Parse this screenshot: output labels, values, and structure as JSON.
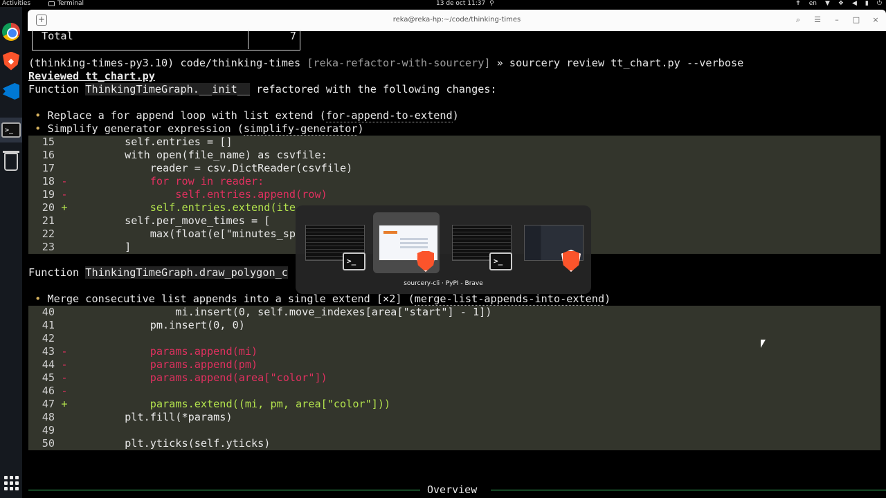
{
  "topbar": {
    "activities": "Activities",
    "app_name": "Terminal",
    "clock": "13 de oct  11:37",
    "language": "en"
  },
  "dock": {
    "items": [
      "chrome-icon",
      "brave-icon",
      "vscode-icon",
      "terminal-icon",
      "trash-icon",
      "app-grid-icon"
    ]
  },
  "terminal": {
    "title": "reka@reka-hp:~/code/thinking-times",
    "table": {
      "label": "Total",
      "value": "7"
    },
    "prompt": {
      "env": "(thinking-times-py3.10) code/thinking-times ",
      "branch": "[reka-refactor-with-sourcery]",
      "command": " » sourcery review tt_chart.py --verbose"
    },
    "reviewed": "Reviewed tt_chart.py",
    "func1": {
      "prefix": "Function ",
      "name": "ThinkingTimeGraph.__init__",
      "suffix": " refactored with the following changes:"
    },
    "bullets1": [
      {
        "text": "Replace a for append loop with list extend (",
        "code": "for-append-to-extend",
        "end": ")"
      },
      {
        "text": "Simplify generator expression (",
        "code": "simplify-generator",
        "end": ")"
      }
    ],
    "diff1": [
      {
        "n": "15",
        "m": " ",
        "t": "        self.entries = []",
        "k": "ctx"
      },
      {
        "n": "16",
        "m": " ",
        "t": "        with open(file_name) as csvfile:",
        "k": "ctx"
      },
      {
        "n": "17",
        "m": " ",
        "t": "            reader = csv.DictReader(csvfile)",
        "k": "ctx"
      },
      {
        "n": "18",
        "m": "-",
        "t": "            for row in reader:",
        "k": "del"
      },
      {
        "n": "19",
        "m": "-",
        "t": "                self.entries.append(row)",
        "k": "del"
      },
      {
        "n": "20",
        "m": "+",
        "t": "            self.entries.extend(ite",
        "k": "add"
      },
      {
        "n": "21",
        "m": " ",
        "t": "        self.per_move_times = [",
        "k": "ctx"
      },
      {
        "n": "22",
        "m": " ",
        "t": "            max(float(e[\"minutes_sp",
        "k": "ctx"
      },
      {
        "n": "23",
        "m": " ",
        "t": "        ]",
        "k": "ctx"
      }
    ],
    "func2": {
      "prefix": "Function ",
      "name": "ThinkingTimeGraph.draw_polygon_c"
    },
    "bullets2": [
      {
        "text": "Merge consecutive list appends into a single extend [×2] (",
        "code": "merge-list-appends-into-extend",
        "end": ")"
      }
    ],
    "diff2": [
      {
        "n": "40",
        "m": " ",
        "t": "                mi.insert(0, self.move_indexes[area[\"start\"] - 1])",
        "k": "ctx"
      },
      {
        "n": "41",
        "m": " ",
        "t": "            pm.insert(0, 0)",
        "k": "ctx"
      },
      {
        "n": "42",
        "m": " ",
        "t": "",
        "k": "ctx"
      },
      {
        "n": "43",
        "m": "-",
        "t": "            params.append(mi)",
        "k": "del"
      },
      {
        "n": "44",
        "m": "-",
        "t": "            params.append(pm)",
        "k": "del"
      },
      {
        "n": "45",
        "m": "-",
        "t": "            params.append(area[\"color\"])",
        "k": "del"
      },
      {
        "n": "46",
        "m": "-",
        "t": "",
        "k": "del"
      },
      {
        "n": "47",
        "m": "+",
        "t": "            params.extend((mi, pm, area[\"color\"]))",
        "k": "add"
      },
      {
        "n": "48",
        "m": " ",
        "t": "        plt.fill(*params)",
        "k": "ctx"
      },
      {
        "n": "49",
        "m": " ",
        "t": "",
        "k": "ctx"
      },
      {
        "n": "50",
        "m": " ",
        "t": "        plt.yticks(self.yticks)",
        "k": "ctx"
      }
    ],
    "overview": "Overview"
  },
  "switcher": {
    "label": "sourcery-cli · PyPI - Brave",
    "windows": [
      "terminal-window",
      "brave-sourcery-window",
      "terminal-window-2",
      "brave-docs-window"
    ]
  }
}
